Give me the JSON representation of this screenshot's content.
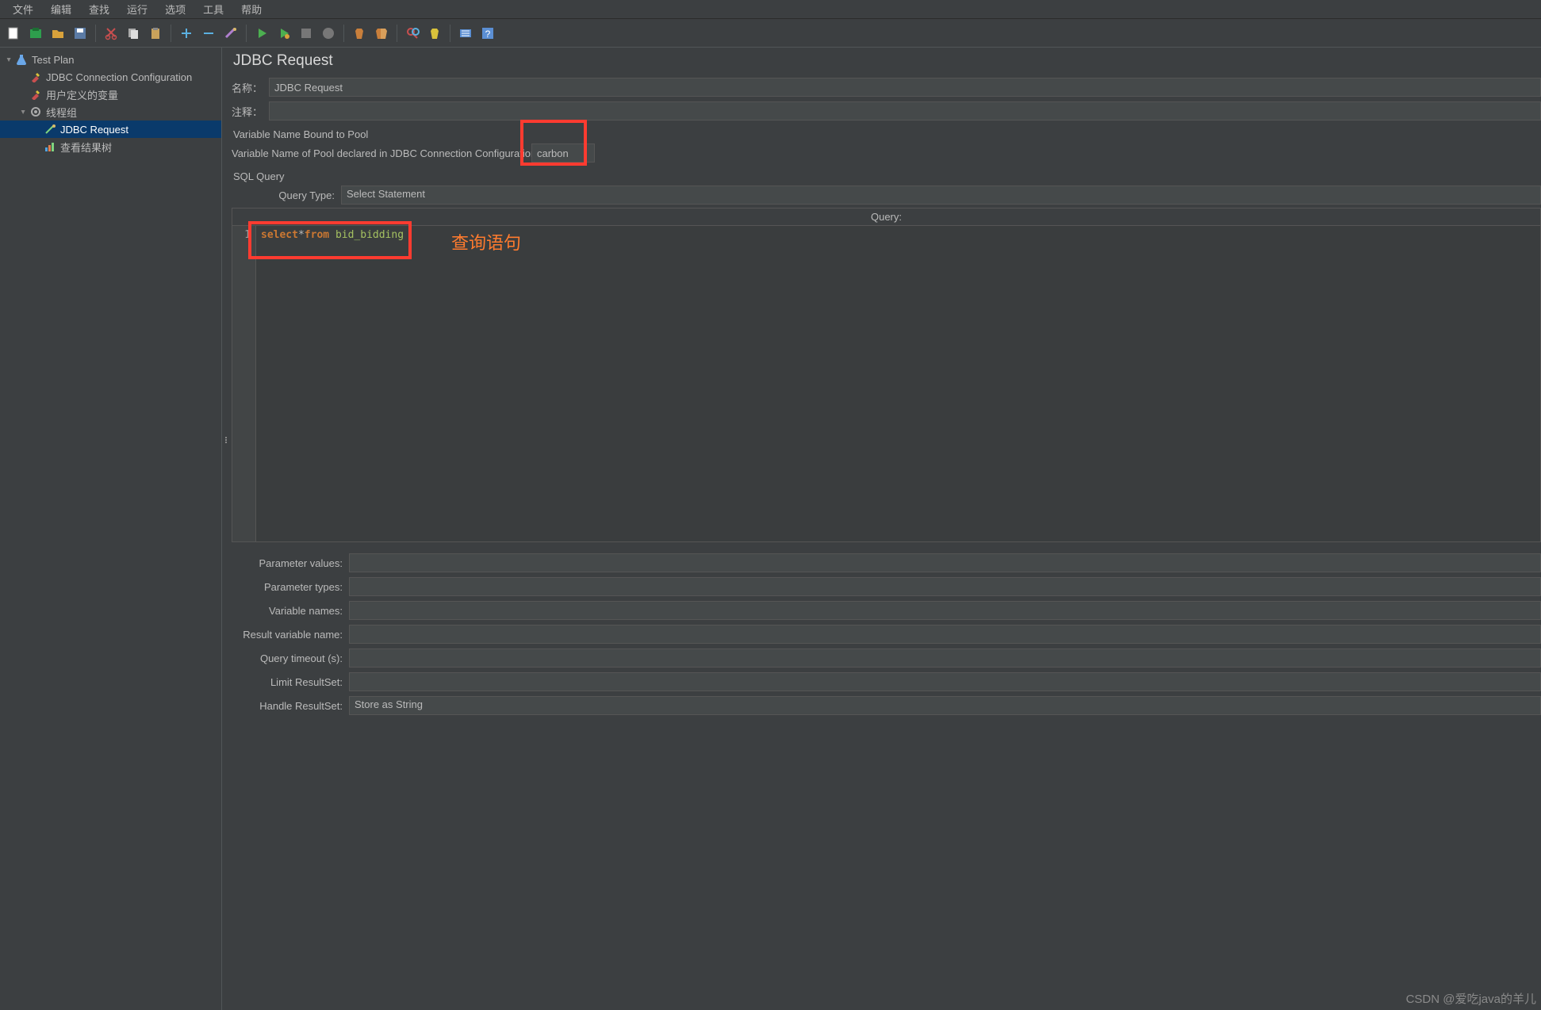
{
  "menu": [
    "文件",
    "编辑",
    "查找",
    "运行",
    "选项",
    "工具",
    "帮助"
  ],
  "tree": {
    "root": "Test Plan",
    "items": [
      "JDBC Connection Configuration",
      "用户定义的变量",
      "线程组"
    ],
    "thread_children": [
      "JDBC Request",
      "查看结果树"
    ]
  },
  "page": {
    "title": "JDBC Request",
    "name_label": "名称：",
    "name_value": "JDBC Request",
    "comment_label": "注释：",
    "comment_value": "",
    "pool_section": "Variable Name Bound to Pool",
    "pool_label": "Variable Name of Pool declared in JDBC Connection Configuration:",
    "pool_value": "carbon",
    "sql_section": "SQL Query",
    "query_type_label": "Query Type:",
    "query_type_value": "Select Statement",
    "query_header": "Query:",
    "line_no": "1",
    "code_kw1": "select",
    "code_star": "*",
    "code_kw2": "from",
    "code_table": "bid_bidding",
    "annotation": "查询语句",
    "fields": {
      "param_values": {
        "label": "Parameter values:",
        "value": ""
      },
      "param_types": {
        "label": "Parameter types:",
        "value": ""
      },
      "var_names": {
        "label": "Variable names:",
        "value": ""
      },
      "result_var": {
        "label": "Result variable name:",
        "value": ""
      },
      "timeout": {
        "label": "Query timeout (s):",
        "value": ""
      },
      "limit": {
        "label": "Limit ResultSet:",
        "value": ""
      },
      "handle": {
        "label": "Handle ResultSet:",
        "value": "Store as String"
      }
    }
  },
  "watermark": "CSDN @爱吃java的羊儿"
}
